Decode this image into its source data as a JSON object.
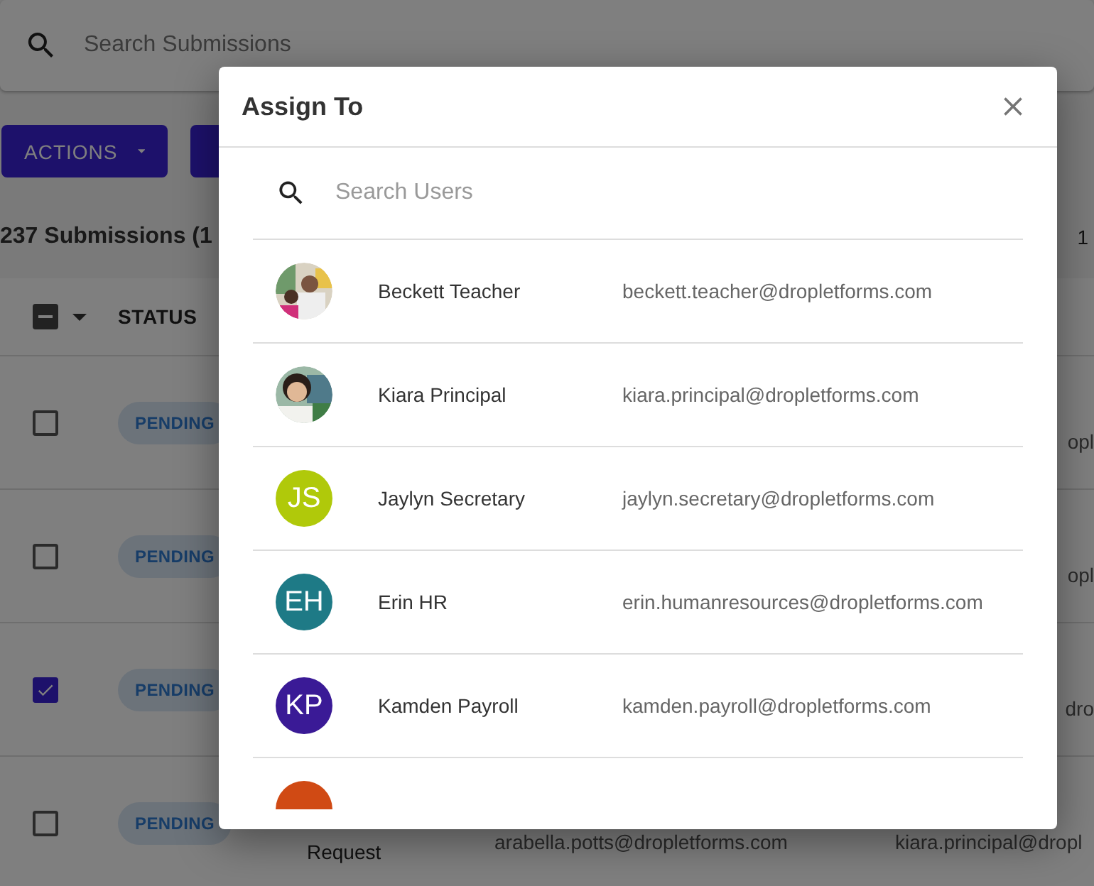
{
  "search": {
    "placeholder": "Search Submissions"
  },
  "buttons": [
    {
      "label": "ACTIONS",
      "dropdown": true
    },
    {
      "dropdown": false
    }
  ],
  "summary": "237 Submissions (1",
  "pager": "1",
  "table": {
    "select_all": {
      "indeterminate": true
    },
    "columns": [
      {
        "label": "STATUS"
      }
    ],
    "rows": [
      {
        "checked": false,
        "status": "PENDING",
        "column_5": "opl"
      },
      {
        "checked": false,
        "status": "PENDING",
        "column_5": "opl"
      },
      {
        "checked": true,
        "status": "PENDING",
        "column_5": "dro"
      },
      {
        "checked": false,
        "status": "PENDING",
        "column_3": "Request",
        "column_4": "arabella.potts@dropletforms.com",
        "column_5": "kiara.principal@dropl"
      }
    ]
  },
  "dialog": {
    "title": "Assign To",
    "search": {
      "placeholder": "Search Users"
    },
    "users": [
      {
        "name": "Beckett Teacher",
        "email": "beckett.teacher@dropletforms.com"
      },
      {
        "name": "Kiara Principal",
        "email": "kiara.principal@dropletforms.com"
      },
      {
        "name": "Jaylyn Secretary",
        "email": "jaylyn.secretary@dropletforms.com",
        "avatar": {
          "kind": "initials",
          "initials": "JS",
          "color": "#b0c90a"
        }
      },
      {
        "name": "Erin HR",
        "email": "erin.humanresources@dropletforms.com",
        "avatar": {
          "kind": "initials",
          "initials": "EH",
          "color": "#1e7a86"
        }
      },
      {
        "name": "Kamden Payroll",
        "email": "kamden.payroll@dropletforms.com",
        "avatar": {
          "kind": "initials",
          "initials": "KP",
          "color": "#3a1a96"
        }
      },
      {
        "avatar": {
          "kind": "initials",
          "color": "#d04a14"
        }
      }
    ]
  }
}
